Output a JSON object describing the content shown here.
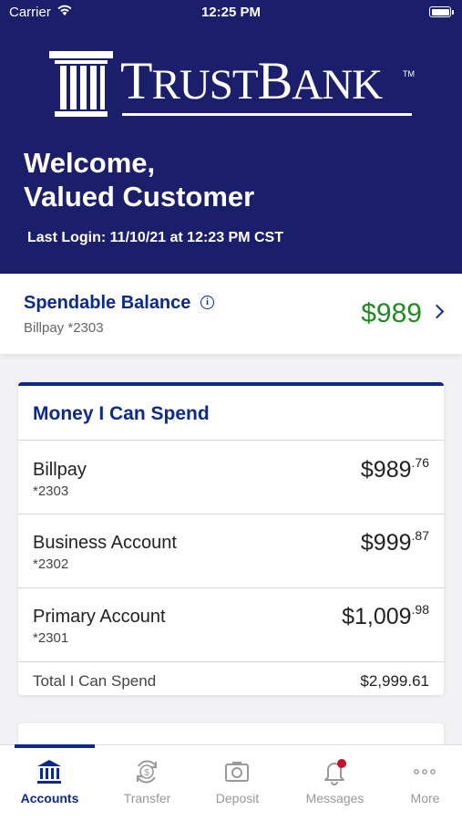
{
  "status_bar": {
    "carrier": "Carrier",
    "time": "12:25 PM"
  },
  "brand": {
    "logo_main": "T",
    "logo_rest": "RUST",
    "logo_b": "B",
    "logo_rest2": "ANK",
    "tm": "TM"
  },
  "header": {
    "welcome_line1": "Welcome,",
    "welcome_line2": "Valued Customer",
    "last_login": "Last Login: 11/10/21 at 12:23 PM CST"
  },
  "spendable": {
    "title": "Spendable Balance",
    "info_glyph": "i",
    "account": "Billpay *2303",
    "amount": "$989"
  },
  "money_card": {
    "title": "Money I Can Spend",
    "accounts": [
      {
        "name": "Billpay",
        "number": "*2303",
        "amount_main": "$989",
        "amount_cents": ".76"
      },
      {
        "name": "Business Account",
        "number": "*2302",
        "amount_main": "$999",
        "amount_cents": ".87"
      },
      {
        "name": "Primary Account",
        "number": "*2301",
        "amount_main": "$1,009",
        "amount_cents": ".98"
      }
    ],
    "total_label": "Total I Can Spend",
    "total_amount": "$2,999.61"
  },
  "tabs": [
    {
      "label": "Accounts",
      "icon": "bank-icon",
      "active": true
    },
    {
      "label": "Transfer",
      "icon": "transfer-icon",
      "active": false
    },
    {
      "label": "Deposit",
      "icon": "camera-icon",
      "active": false
    },
    {
      "label": "Messages",
      "icon": "bell-icon",
      "active": false
    },
    {
      "label": "More",
      "icon": "more-icon",
      "active": false
    }
  ],
  "colors": {
    "header_bg": "#1b1f6b",
    "brand_blue": "#0b2a8c",
    "positive_green": "#1f8a1f",
    "notification_red": "#c8102e"
  }
}
